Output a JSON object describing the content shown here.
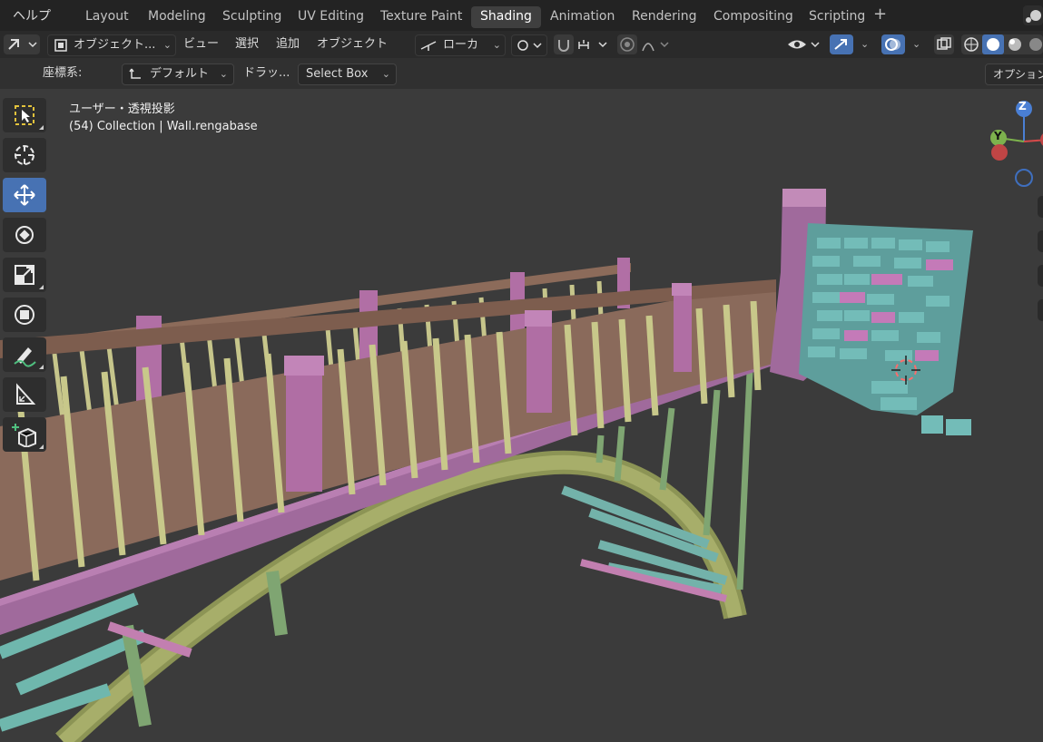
{
  "topbar": {
    "help_menu": "ヘルプ",
    "workspaces": [
      {
        "label": "Layout",
        "active": false
      },
      {
        "label": "Modeling",
        "active": false
      },
      {
        "label": "Sculpting",
        "active": false
      },
      {
        "label": "UV Editing",
        "active": false
      },
      {
        "label": "Texture Paint",
        "active": false
      },
      {
        "label": "Shading",
        "active": true
      },
      {
        "label": "Animation",
        "active": false
      },
      {
        "label": "Rendering",
        "active": false
      },
      {
        "label": "Compositing",
        "active": false
      },
      {
        "label": "Scripting",
        "active": false
      }
    ],
    "add_workspace_icon": "plus-icon"
  },
  "viewport_header": {
    "mode": "オブジェクト...",
    "menus": [
      "ビュー",
      "選択",
      "追加",
      "オブジェクト"
    ],
    "transform_orientation": "ローカ"
  },
  "tool_settings": {
    "coord_label": "座標系:",
    "coord_value": "デフォルト",
    "drag_label": "ドラッ...",
    "select_value": "Select Box",
    "options_label": "オプション"
  },
  "viewport": {
    "view_name": "ユーザー・透視投影",
    "collection_info": "(54) Collection | Wall.rengabase"
  },
  "gizmo": {
    "z": "Z",
    "y": "Y"
  },
  "colors": {
    "accent_blue": "#4772b3",
    "rail_pink": "#b36fa6",
    "rail_brown": "#8a6a5b",
    "baluster_yellow": "#c8c88a",
    "arch_green": "#9ea56c",
    "wall_teal": "#6fb7b5",
    "wall_pink": "#c47ab8"
  }
}
